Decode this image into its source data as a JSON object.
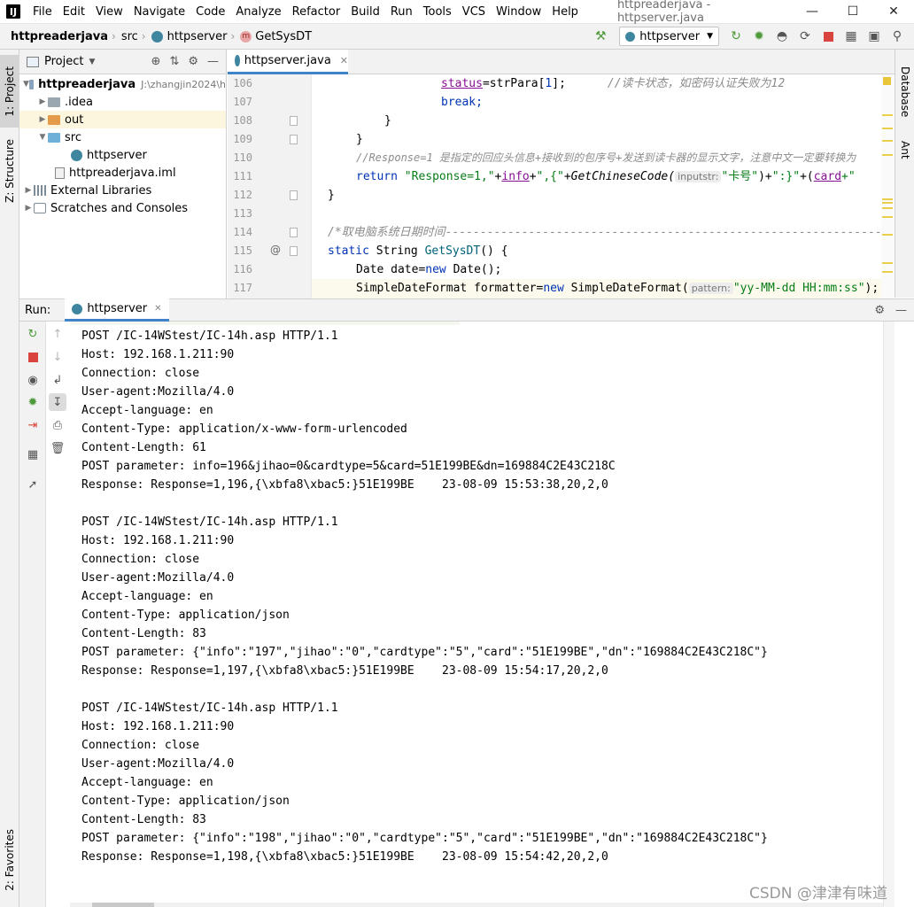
{
  "window": {
    "title": "httpreaderjava - httpserver.java"
  },
  "menu": [
    "File",
    "Edit",
    "View",
    "Navigate",
    "Code",
    "Analyze",
    "Refactor",
    "Build",
    "Run",
    "Tools",
    "VCS",
    "Window",
    "Help"
  ],
  "breadcrumb": {
    "project": "httpreaderjava",
    "folder": "src",
    "class": "httpserver",
    "method": "GetSysDT"
  },
  "run_config": "httpserver",
  "side_tabs": {
    "project": "1: Project",
    "structure": "Z: Structure",
    "favorites": "2: Favorites",
    "database": "Database",
    "ant": "Ant"
  },
  "project_panel": {
    "title": "Project",
    "tree": [
      {
        "label": "httpreaderjava",
        "extra": "J:\\zhangjin2024\\h"
      },
      {
        "label": ".idea"
      },
      {
        "label": "out"
      },
      {
        "label": "src"
      },
      {
        "label": "httpserver"
      },
      {
        "label": "httpreaderjava.iml"
      },
      {
        "label": "External Libraries"
      },
      {
        "label": "Scratches and Consoles"
      }
    ]
  },
  "editor": {
    "tab": "httpserver.java",
    "lines": [
      {
        "n": "106",
        "t": {
          "a": "status",
          "b": "=strPara[",
          "c": "1",
          "d": "];",
          "e": "//读卡状态，如密码认证失败为12"
        }
      },
      {
        "n": "107",
        "t": {
          "a": "break;"
        }
      },
      {
        "n": "108",
        "t": {
          "a": "}"
        }
      },
      {
        "n": "109",
        "t": {
          "a": "}"
        }
      },
      {
        "n": "110",
        "t": {
          "a": "//Response=1 是指定的回应头信息+接收到的包序号+发送到读卡器的显示文字，注意中文一定要转换为"
        }
      },
      {
        "n": "111",
        "t": {
          "a": "return ",
          "b": "\"Response=1,\"",
          "c": "+",
          "d": "info",
          "e": "+",
          "f": "\",{\"",
          "g": "+",
          "h": "GetChineseCode(",
          "i": "inputstr:",
          "j": "\"卡号\"",
          "k": ")+",
          "l": "\":}\"",
          "m": "+(",
          "n2": "card",
          "o": "+\""
        }
      },
      {
        "n": "112",
        "t": {
          "a": "}"
        }
      },
      {
        "n": "113",
        "t": {
          "a": ""
        }
      },
      {
        "n": "114",
        "t": {
          "a": "/*取电脑系统日期时间-----------------------------------------------------------------"
        }
      },
      {
        "n": "115",
        "t": {
          "a": "static ",
          "b": "String ",
          "c": "GetSysDT",
          "d": "() {"
        }
      },
      {
        "n": "116",
        "t": {
          "a": "Date date=",
          "b": "new ",
          "c": "Date();"
        }
      },
      {
        "n": "117",
        "t": {
          "a": "SimpleDateFormat formatter=",
          "b": "new ",
          "c": "SimpleDateFormat(",
          "d": "pattern:",
          "e": "\"yy-MM-dd HH:mm:ss\"",
          "f": ");"
        }
      }
    ]
  },
  "run": {
    "label": "Run:",
    "tab": "httpserver",
    "console": [
      "POST /IC-14WStest/IC-14h.asp HTTP/1.1",
      "Host: 192.168.1.211:90",
      "Connection: close",
      "User-agent:Mozilla/4.0",
      "Accept-language: en",
      "Content-Type: application/x-www-form-urlencoded",
      "Content-Length: 61",
      "POST parameter: info=196&jihao=0&cardtype=5&card=51E199BE&dn=169884C2E43C218C",
      "Response: Response=1,196,{\\xbfa8\\xbac5:}51E199BE    23-08-09 15:53:38,20,2,0",
      "",
      "POST /IC-14WStest/IC-14h.asp HTTP/1.1",
      "Host: 192.168.1.211:90",
      "Connection: close",
      "User-agent:Mozilla/4.0",
      "Accept-language: en",
      "Content-Type: application/json",
      "Content-Length: 83",
      "POST parameter: {\"info\":\"197\",\"jihao\":\"0\",\"cardtype\":\"5\",\"card\":\"51E199BE\",\"dn\":\"169884C2E43C218C\"}",
      "Response: Response=1,197,{\\xbfa8\\xbac5:}51E199BE    23-08-09 15:54:17,20,2,0",
      "",
      "POST /IC-14WStest/IC-14h.asp HTTP/1.1",
      "Host: 192.168.1.211:90",
      "Connection: close",
      "User-agent:Mozilla/4.0",
      "Accept-language: en",
      "Content-Type: application/json",
      "Content-Length: 83",
      "POST parameter: {\"info\":\"198\",\"jihao\":\"0\",\"cardtype\":\"5\",\"card\":\"51E199BE\",\"dn\":\"169884C2E43C218C\"}",
      "Response: Response=1,198,{\\xbfa8\\xbac5:}51E199BE    23-08-09 15:54:42,20,2,0"
    ]
  },
  "watermark": "CSDN @津津有味道"
}
